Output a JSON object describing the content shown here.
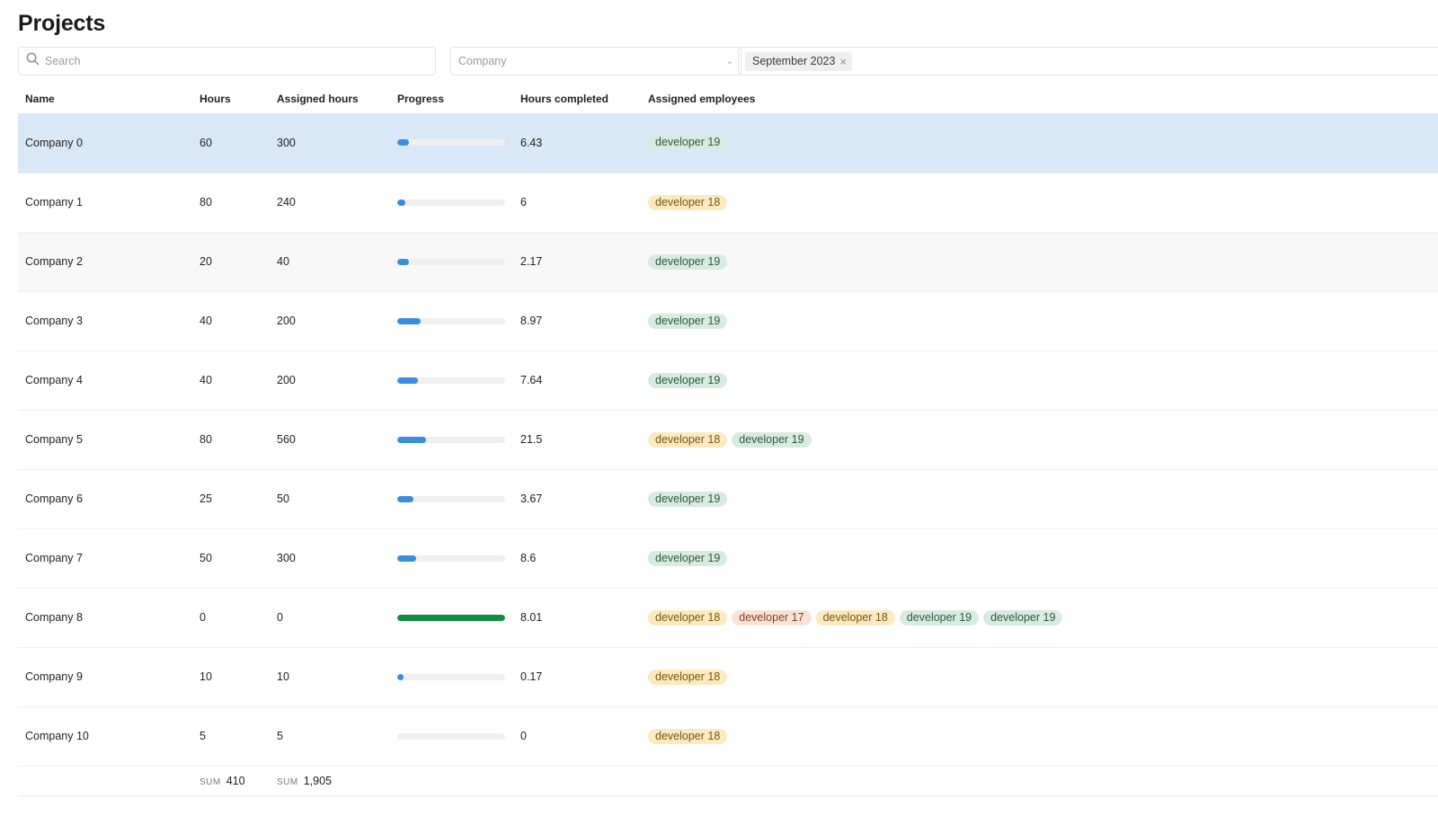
{
  "page": {
    "title": "Projects"
  },
  "filters": {
    "search": {
      "placeholder": "Search",
      "value": ""
    },
    "company": {
      "placeholder": "Company"
    },
    "period_chip": {
      "label": "September 2023",
      "remove_glyph": "×"
    }
  },
  "table": {
    "columns": [
      "Name",
      "Hours",
      "Assigned hours",
      "Progress",
      "Hours completed",
      "Assigned employees"
    ],
    "rows": [
      {
        "name": "Company 0",
        "hours": "60",
        "assigned_hours": "300",
        "progress": 0.11,
        "progress_status": "in-progress",
        "hours_completed": "6.43",
        "employees": [
          {
            "label": "developer 19",
            "color": "green"
          }
        ],
        "selected": true
      },
      {
        "name": "Company 1",
        "hours": "80",
        "assigned_hours": "240",
        "progress": 0.075,
        "progress_status": "in-progress",
        "hours_completed": "6",
        "employees": [
          {
            "label": "developer 18",
            "color": "yellow"
          }
        ]
      },
      {
        "name": "Company 2",
        "hours": "20",
        "assigned_hours": "40",
        "progress": 0.11,
        "progress_status": "in-progress",
        "hours_completed": "2.17",
        "employees": [
          {
            "label": "developer 19",
            "color": "green"
          }
        ],
        "hovered": true
      },
      {
        "name": "Company 3",
        "hours": "40",
        "assigned_hours": "200",
        "progress": 0.22,
        "progress_status": "in-progress",
        "hours_completed": "8.97",
        "employees": [
          {
            "label": "developer 19",
            "color": "green"
          }
        ]
      },
      {
        "name": "Company 4",
        "hours": "40",
        "assigned_hours": "200",
        "progress": 0.19,
        "progress_status": "in-progress",
        "hours_completed": "7.64",
        "employees": [
          {
            "label": "developer 19",
            "color": "green"
          }
        ]
      },
      {
        "name": "Company 5",
        "hours": "80",
        "assigned_hours": "560",
        "progress": 0.27,
        "progress_status": "in-progress",
        "hours_completed": "21.5",
        "employees": [
          {
            "label": "developer 18",
            "color": "yellow"
          },
          {
            "label": "developer 19",
            "color": "green"
          }
        ]
      },
      {
        "name": "Company 6",
        "hours": "25",
        "assigned_hours": "50",
        "progress": 0.147,
        "progress_status": "in-progress",
        "hours_completed": "3.67",
        "employees": [
          {
            "label": "developer 19",
            "color": "green"
          }
        ]
      },
      {
        "name": "Company 7",
        "hours": "50",
        "assigned_hours": "300",
        "progress": 0.172,
        "progress_status": "in-progress",
        "hours_completed": "8.6",
        "employees": [
          {
            "label": "developer 19",
            "color": "green"
          }
        ]
      },
      {
        "name": "Company 8",
        "hours": "0",
        "assigned_hours": "0",
        "progress": 1.0,
        "progress_status": "complete",
        "hours_completed": "8.01",
        "employees": [
          {
            "label": "developer 18",
            "color": "yellow"
          },
          {
            "label": "developer 17",
            "color": "peach"
          },
          {
            "label": "developer 18",
            "color": "yellow"
          },
          {
            "label": "developer 19",
            "color": "green"
          },
          {
            "label": "developer 19",
            "color": "green"
          }
        ]
      },
      {
        "name": "Company 9",
        "hours": "10",
        "assigned_hours": "10",
        "progress": 0.017,
        "progress_status": "in-progress",
        "hours_completed": "0.17",
        "employees": [
          {
            "label": "developer 18",
            "color": "yellow"
          }
        ]
      },
      {
        "name": "Company 10",
        "hours": "5",
        "assigned_hours": "5",
        "progress": 0,
        "progress_status": "in-progress",
        "hours_completed": "0",
        "employees": [
          {
            "label": "developer 18",
            "color": "yellow"
          }
        ]
      }
    ],
    "footer": {
      "sum_label": "SUM",
      "hours_sum": "410",
      "assigned_hours_sum": "1,905"
    }
  },
  "colors": {
    "progress_fill": "#3a8ddd",
    "progress_complete": "#138a43",
    "selected_row": "#d9e8f6",
    "tag_green": "#d8ebe0",
    "tag_yellow": "#fbe9bf",
    "tag_peach": "#f9e2d8"
  }
}
